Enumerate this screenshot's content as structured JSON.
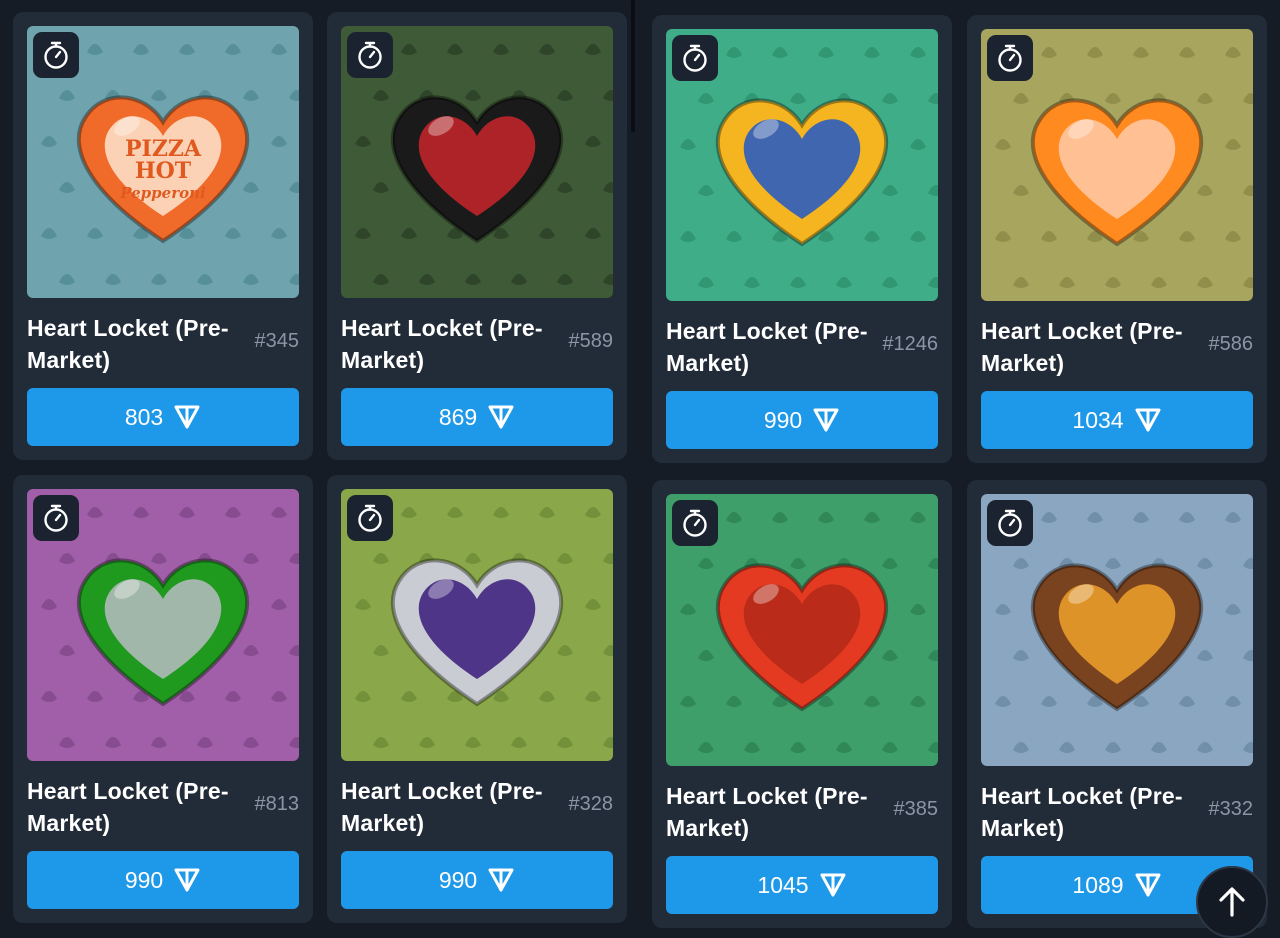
{
  "currency_icon": "ton-diamond-icon",
  "cards": [
    {
      "title": "Heart Locket (Pre-Market)",
      "number": "#345",
      "price": "803",
      "bg": "#6fa3ad",
      "bg_dark": "#4f8893",
      "heart": "#f06a2a",
      "heart_inner": "#fde4cf",
      "label_lines": [
        "PIZZA",
        "HOT",
        "Pepperoni"
      ],
      "label_color": "#e05a20"
    },
    {
      "title": "Heart Locket (Pre-Market)",
      "number": "#589",
      "price": "869",
      "bg": "#3f5a36",
      "bg_dark": "#2a3f25",
      "heart": "#1a1a1a",
      "heart_inner": "#c8262a",
      "label_lines": [],
      "label_color": "#ffffff"
    },
    {
      "title": "Heart Locket (Pre-Market)",
      "number": "#1246",
      "price": "990",
      "bg": "#3fae88",
      "bg_dark": "#2d8f6c",
      "heart": "#f5b521",
      "heart_inner": "#1f58c7",
      "label_lines": [],
      "label_color": "#ffffff"
    },
    {
      "title": "Heart Locket (Pre-Market)",
      "number": "#586",
      "price": "1034",
      "bg": "#a8a55e",
      "bg_dark": "#8a8745",
      "heart": "#ff8a1f",
      "heart_inner": "#ffc9a8",
      "label_lines": [],
      "label_color": "#ffffff"
    },
    {
      "title": "Heart Locket (Pre-Market)",
      "number": "#813",
      "price": "990",
      "bg": "#a05fa8",
      "bg_dark": "#7f4588",
      "heart": "#1f9a1f",
      "heart_inner": "#b9bcc2",
      "label_lines": [],
      "label_color": "#ffffff"
    },
    {
      "title": "Heart Locket (Pre-Market)",
      "number": "#328",
      "price": "990",
      "bg": "#8aa84a",
      "bg_dark": "#6a8a35",
      "heart": "#c9ccd2",
      "heart_inner": "#3a1a7a",
      "label_lines": [],
      "label_color": "#ffffff"
    },
    {
      "title": "Heart Locket (Pre-Market)",
      "number": "#385",
      "price": "1045",
      "bg": "#3f9f6a",
      "bg_dark": "#2c7f52",
      "heart": "#e43a22",
      "heart_inner": "#b32a18",
      "label_lines": [],
      "label_color": "#ffffff"
    },
    {
      "title": "Heart Locket (Pre-Market)",
      "number": "#332",
      "price": "1089",
      "bg": "#8aa6c0",
      "bg_dark": "#6a87a2",
      "heart": "#7a4320",
      "heart_inner": "#f0a12a",
      "label_lines": [],
      "label_color": "#ffffff"
    }
  ],
  "scroll_top_icon": "arrow-up-icon"
}
